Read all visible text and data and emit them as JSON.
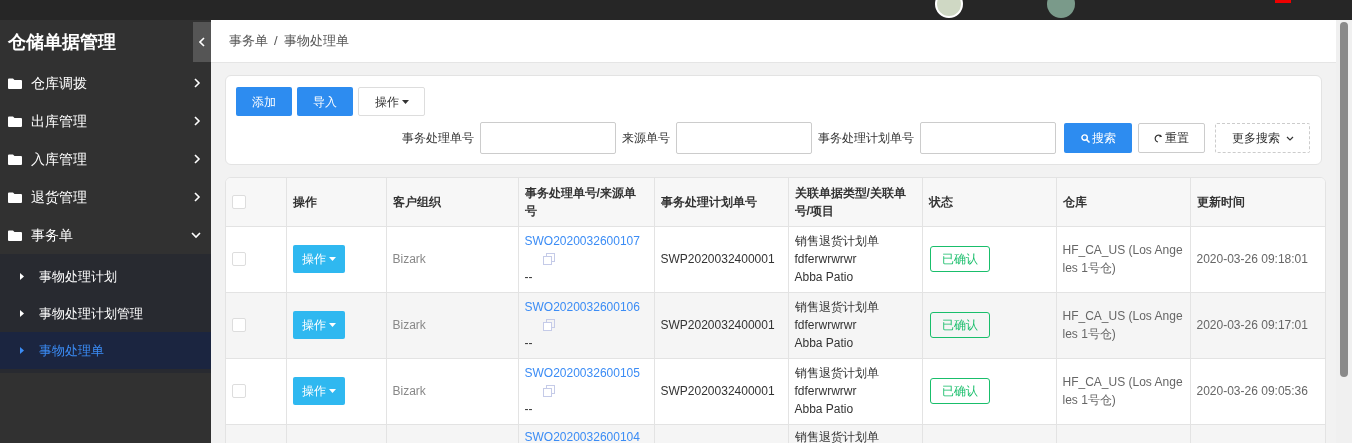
{
  "sidebar": {
    "title": "仓储单据管理",
    "items": [
      {
        "label": "仓库调拨",
        "expanded": false
      },
      {
        "label": "出库管理",
        "expanded": false
      },
      {
        "label": "入库管理",
        "expanded": false
      },
      {
        "label": "退货管理",
        "expanded": false
      },
      {
        "label": "事务单",
        "expanded": true,
        "children": [
          {
            "label": "事物处理计划",
            "selected": false
          },
          {
            "label": "事物处理计划管理",
            "selected": false
          },
          {
            "label": "事物处理单",
            "selected": true
          }
        ]
      }
    ]
  },
  "breadcrumb": [
    "事务单",
    "/",
    "事物处理单"
  ],
  "toolbar": {
    "buttons": [
      "添加",
      "导入"
    ],
    "dropdown": "操作"
  },
  "search": {
    "fields": [
      {
        "label": "事务处理单号"
      },
      {
        "label": "来源单号"
      },
      {
        "label": "事务处理计划单号"
      }
    ],
    "search_button": "搜索",
    "reset_button": "重置",
    "more_button": "更多搜索"
  },
  "table": {
    "all_checked": false,
    "columns": [
      "操作",
      "客户组织",
      "事务处理单号/来源单号",
      "事务处理计划单号",
      "关联单据类型/关联单号/项目",
      "状态",
      "仓库",
      "更新时间"
    ],
    "rows": [
      {
        "checked": false,
        "action": "操作",
        "org": "Bizark",
        "order_no": "SWO2020032600107",
        "source_no": "--",
        "plan_no": "SWP2020032400001",
        "related": [
          "销售退货计划单",
          "fdferwrwrwr",
          "Abba Patio"
        ],
        "status": "已确认",
        "warehouse": "HF_CA_US (Los Angeles 1号仓)",
        "updated": "2020-03-26 09:18:01"
      },
      {
        "checked": false,
        "action": "操作",
        "org": "Bizark",
        "order_no": "SWO2020032600106",
        "source_no": "--",
        "plan_no": "SWP2020032400001",
        "related": [
          "销售退货计划单",
          "fdferwrwrwr",
          "Abba Patio"
        ],
        "status": "已确认",
        "warehouse": "HF_CA_US (Los Angeles 1号仓)",
        "updated": "2020-03-26 09:17:01"
      },
      {
        "checked": false,
        "action": "操作",
        "org": "Bizark",
        "order_no": "SWO2020032600105",
        "source_no": "--",
        "plan_no": "SWP2020032400001",
        "related": [
          "销售退货计划单",
          "fdferwrwrwr",
          "Abba Patio"
        ],
        "status": "已确认",
        "warehouse": "HF_CA_US (Los Angeles 1号仓)",
        "updated": "2020-03-26 09:05:36"
      },
      {
        "order_no": "SWO2020032600104",
        "related": [
          "销售退货计划单"
        ]
      }
    ]
  }
}
